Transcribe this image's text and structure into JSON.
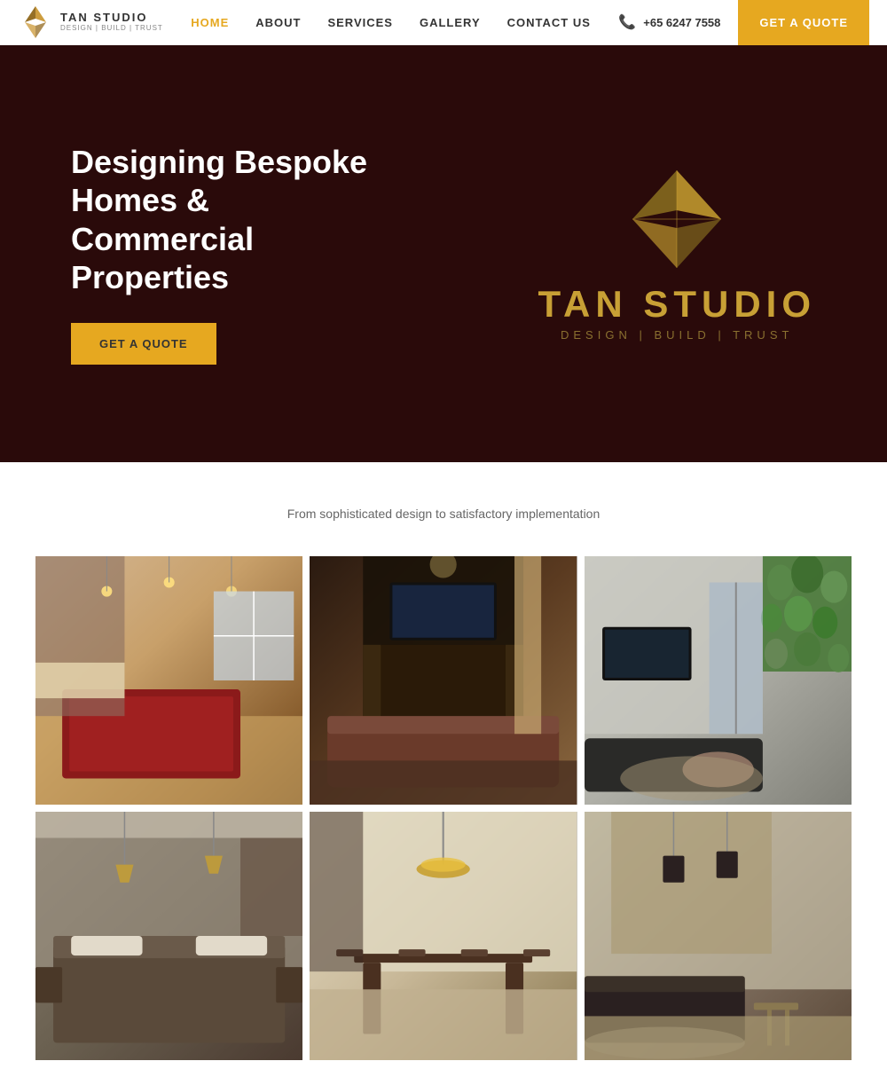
{
  "navbar": {
    "logo": {
      "brand": "TAN STUDIO",
      "tagline": "DESIGN | BUILD | TRUST"
    },
    "links": [
      {
        "label": "HOME",
        "active": true
      },
      {
        "label": "ABOUT",
        "active": false
      },
      {
        "label": "SERVICES",
        "active": false
      },
      {
        "label": "GALLERY",
        "active": false
      },
      {
        "label": "CONTACT US",
        "active": false
      }
    ],
    "phone": "+65 6247 7558",
    "cta": "GET A QUOTE"
  },
  "hero": {
    "title": "Designing Bespoke Homes & Commercial Properties",
    "cta": "GET A QUOTE",
    "brand_name": "TAN STUDIO",
    "brand_tagline": "DESIGN  |  BUILD  |  TRUST"
  },
  "section": {
    "subtitle": "From sophisticated design to satisfactory implementation"
  },
  "gallery": {
    "images": [
      {
        "alt": "Interior room with pool table"
      },
      {
        "alt": "Living room with TV unit"
      },
      {
        "alt": "Modern living room with green wall"
      },
      {
        "alt": "Bedroom interior"
      },
      {
        "alt": "Dining area"
      },
      {
        "alt": "Contemporary living space"
      }
    ]
  }
}
